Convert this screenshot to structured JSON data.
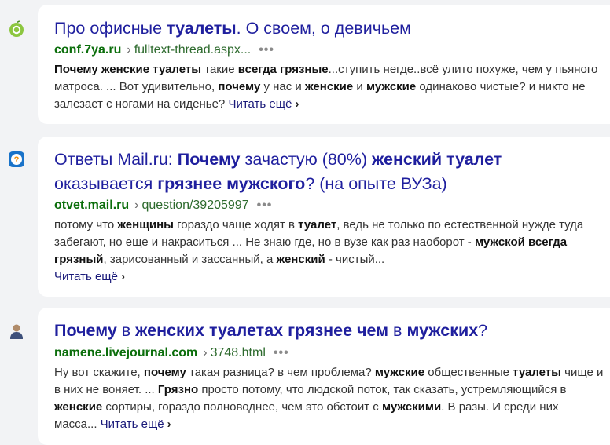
{
  "results": [
    {
      "icon": "apple-icon",
      "title_parts": [
        {
          "t": "Про офисные ",
          "b": false
        },
        {
          "t": "туалеты",
          "b": true
        },
        {
          "t": ". О своем, о девичьем",
          "b": false
        }
      ],
      "domain": "conf.7ya.ru",
      "separator": "›",
      "path": "fulltext-thread.aspx...",
      "dots": "•••",
      "snippet_parts": [
        {
          "t": "Почему женские туалеты",
          "b": true
        },
        {
          "t": " такие ",
          "b": false
        },
        {
          "t": "всегда грязные",
          "b": true
        },
        {
          "t": "...ступить негде..всё улито похуже, чем у пьяного матроса. ... Вот удивительно, ",
          "b": false
        },
        {
          "t": "почему",
          "b": true
        },
        {
          "t": " у нас и ",
          "b": false
        },
        {
          "t": "женские",
          "b": true
        },
        {
          "t": " и ",
          "b": false
        },
        {
          "t": "мужские",
          "b": true
        },
        {
          "t": " одинаково чистые? и никто не залезает с ногами на сиденье?",
          "b": false
        }
      ],
      "more_label": "Читать ещё",
      "more_chevron": "›"
    },
    {
      "icon": "question-icon",
      "title_parts": [
        {
          "t": "Ответы Mail.ru: ",
          "b": false
        },
        {
          "t": "Почему",
          "b": true
        },
        {
          "t": " зачастую (80%) ",
          "b": false
        },
        {
          "t": "женский туалет",
          "b": true
        },
        {
          "t": " оказывается ",
          "b": false
        },
        {
          "t": "грязнее мужского",
          "b": true
        },
        {
          "t": "? (на опыте ВУЗа)",
          "b": false
        }
      ],
      "domain": "otvet.mail.ru",
      "separator": "›",
      "path": "question/39205997",
      "dots": "•••",
      "snippet_parts": [
        {
          "t": "потому что ",
          "b": false
        },
        {
          "t": "женщины",
          "b": true
        },
        {
          "t": " гораздо чаще ходят в ",
          "b": false
        },
        {
          "t": "туалет",
          "b": true
        },
        {
          "t": ", ведь не только по естественной нужде туда забегают, но еще и накраситься ... Не знаю где, но в вузе как раз наоборот - ",
          "b": false
        },
        {
          "t": "мужской всегда грязный",
          "b": true
        },
        {
          "t": ", зарисованный и зассанный, а ",
          "b": false
        },
        {
          "t": "женский",
          "b": true
        },
        {
          "t": " - чистый...",
          "b": false
        }
      ],
      "more_label": "Читать ещё",
      "more_chevron": "›"
    },
    {
      "icon": "user-avatar-icon",
      "title_parts": [
        {
          "t": "Почему",
          "b": true
        },
        {
          "t": " в ",
          "b": false
        },
        {
          "t": "женских туалетах грязнее чем",
          "b": true
        },
        {
          "t": " в ",
          "b": false
        },
        {
          "t": "мужских",
          "b": true
        },
        {
          "t": "?",
          "b": false
        }
      ],
      "domain": "namene.livejournal.com",
      "separator": "›",
      "path": "3748.html",
      "dots": "•••",
      "snippet_parts": [
        {
          "t": "Ну вот скажите, ",
          "b": false
        },
        {
          "t": "почему",
          "b": true
        },
        {
          "t": " такая разница? в чем проблема? ",
          "b": false
        },
        {
          "t": "мужские",
          "b": true
        },
        {
          "t": " общественные ",
          "b": false
        },
        {
          "t": "туалеты",
          "b": true
        },
        {
          "t": " чище и в них не воняет. ... ",
          "b": false
        },
        {
          "t": "Грязно",
          "b": true
        },
        {
          "t": " просто потому, что людской поток, так сказать, устремляющийся в ",
          "b": false
        },
        {
          "t": "женские",
          "b": true
        },
        {
          "t": " сортиры, гораздо полноводнее, чем это обстоит с ",
          "b": false
        },
        {
          "t": "мужскими",
          "b": true
        },
        {
          "t": ". В разы. И среди них масса...",
          "b": false
        }
      ],
      "more_label": "Читать ещё",
      "more_chevron": "›"
    }
  ]
}
